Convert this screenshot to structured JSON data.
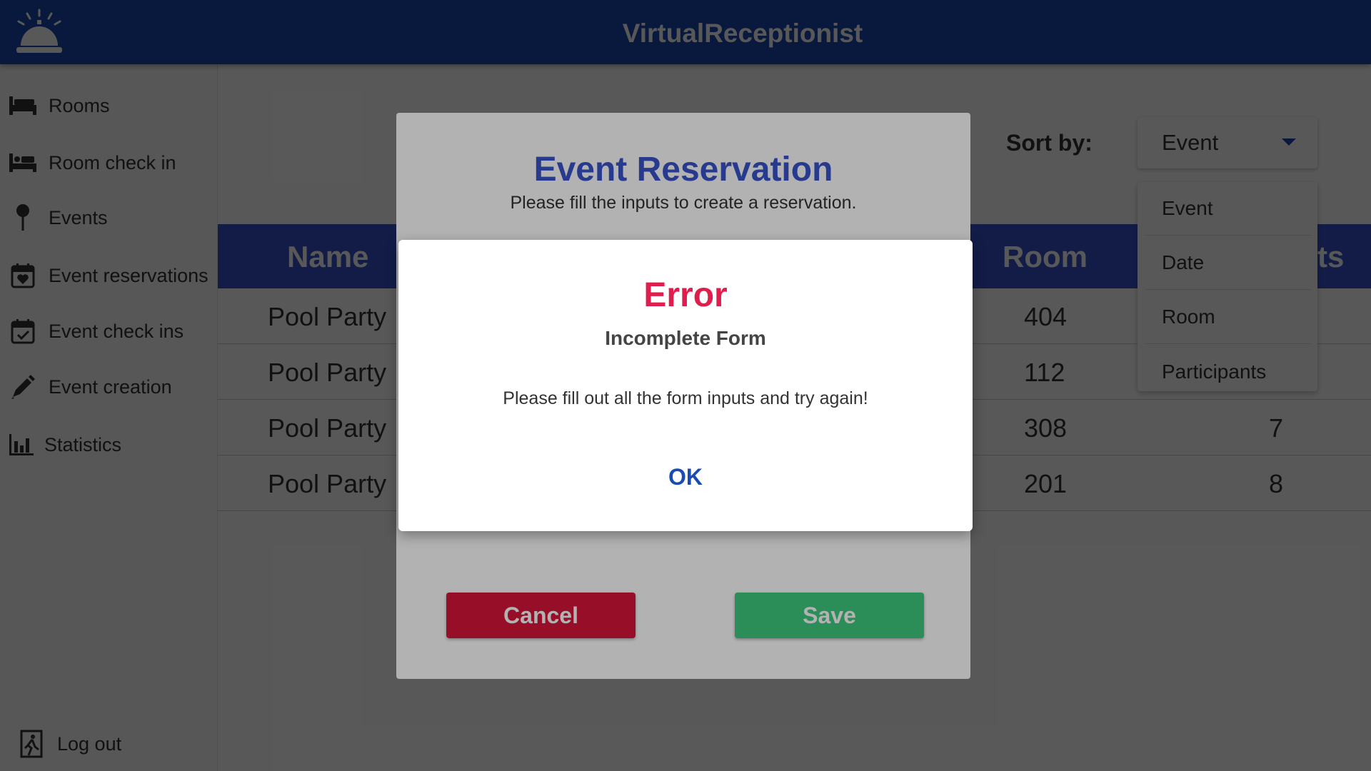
{
  "header": {
    "title": "VirtualReceptionist",
    "logo_icon": "bell-icon"
  },
  "sidebar": {
    "items": [
      {
        "label": "Rooms",
        "icon": "bed-icon"
      },
      {
        "label": "Room check in",
        "icon": "bed-person-icon"
      },
      {
        "label": "Events",
        "icon": "pin-icon"
      },
      {
        "label": "Event reservations",
        "icon": "calendar-heart-icon"
      },
      {
        "label": "Event check ins",
        "icon": "calendar-check-icon"
      },
      {
        "label": "Event creation",
        "icon": "pen-icon"
      },
      {
        "label": "Statistics",
        "icon": "bar-chart-icon"
      }
    ],
    "logout": {
      "label": "Log out",
      "icon": "exit-icon"
    }
  },
  "main": {
    "sort": {
      "label": "Sort by:",
      "selected": "Event",
      "options": [
        "Event",
        "Date",
        "Room",
        "Participants"
      ]
    },
    "table": {
      "columns": [
        "Name",
        "Room",
        "ts"
      ],
      "rows": [
        {
          "name": "Pool Party",
          "room": "404",
          "participants": ""
        },
        {
          "name": "Pool Party",
          "room": "112",
          "participants": ""
        },
        {
          "name": "Pool Party",
          "room": "308",
          "participants": "7"
        },
        {
          "name": "Pool Party",
          "room": "201",
          "participants": "8"
        }
      ]
    }
  },
  "form_dialog": {
    "title": "Event Reservation",
    "subtitle": "Please fill the inputs to create a reservation.",
    "cancel_label": "Cancel",
    "save_label": "Save"
  },
  "error_dialog": {
    "title": "Error",
    "subtitle": "Incomplete Form",
    "message": "Please fill out all the form inputs and try again!",
    "ok_label": "OK"
  },
  "colors": {
    "header": "#1a4bb3",
    "table_header": "#3953cc",
    "error": "#e01e4e",
    "cancel": "#d7153a",
    "save": "#3ecb7e"
  }
}
